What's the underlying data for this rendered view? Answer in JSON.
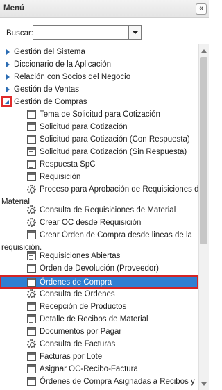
{
  "panel": {
    "title": "Menú",
    "collapse_icon": "«"
  },
  "search": {
    "label": "Buscar:",
    "value": "",
    "placeholder": ""
  },
  "tree": {
    "folders": [
      {
        "label": "Gestión del Sistema",
        "expanded": false
      },
      {
        "label": "Diccionario de la Aplicación",
        "expanded": false
      },
      {
        "label": "Relación con Socios del Negocio",
        "expanded": false
      },
      {
        "label": "Gestión de Ventas",
        "expanded": false
      },
      {
        "label": "Gestión de Compras",
        "expanded": true
      }
    ],
    "items": [
      {
        "label": "Tema de Solicitud para Cotización",
        "icon": "form-icon"
      },
      {
        "label": "Solicitud para Cotización",
        "icon": "form-icon"
      },
      {
        "label": "Solicitud para Cotización (Con Respuesta)",
        "icon": "form-icon"
      },
      {
        "label": "Solicitud para Cotización (Sin Respuesta)",
        "icon": "report-icon"
      },
      {
        "label": "Respuesta SpC",
        "icon": "report-icon"
      },
      {
        "label": "Requisición",
        "icon": "form-icon"
      },
      {
        "label": "Proceso para Aprobación de Requisiciones de",
        "continuation": "Material",
        "icon": "process-icon"
      },
      {
        "label": "Consulta de Requisiciones de Material",
        "icon": "process-icon"
      },
      {
        "label": "Crear OC desde Requisición",
        "icon": "process-icon"
      },
      {
        "label": "Crear Órden de Compra desde lineas de la",
        "continuation": "requisición.",
        "icon": "form-icon"
      },
      {
        "label": "Requisiciones Abiertas",
        "icon": "report-icon"
      },
      {
        "label": "Orden de Devolución (Proveedor)",
        "icon": "form-icon"
      },
      {
        "label": "Órdenes de Compra",
        "icon": "form-icon",
        "selected": true
      },
      {
        "label": "Consulta de Ordenes",
        "icon": "process-icon"
      },
      {
        "label": "Recepción de Productos",
        "icon": "form-icon"
      },
      {
        "label": "Detalle de Recibos de Material",
        "icon": "report-icon"
      },
      {
        "label": "Documentos por Pagar",
        "icon": "form-icon"
      },
      {
        "label": "Consulta de Facturas",
        "icon": "process-icon"
      },
      {
        "label": "Facturas por Lote",
        "icon": "form-icon"
      },
      {
        "label": "Asignar OC-Recibo-Factura",
        "icon": "form-icon"
      },
      {
        "label": "Órdenes de Compra Asignadas a Recibos y",
        "icon": "form-icon"
      }
    ]
  },
  "colors": {
    "selection": "#2f7fd2",
    "highlight_border": "#d42424",
    "expand_arrow": "#2b6cb3"
  }
}
